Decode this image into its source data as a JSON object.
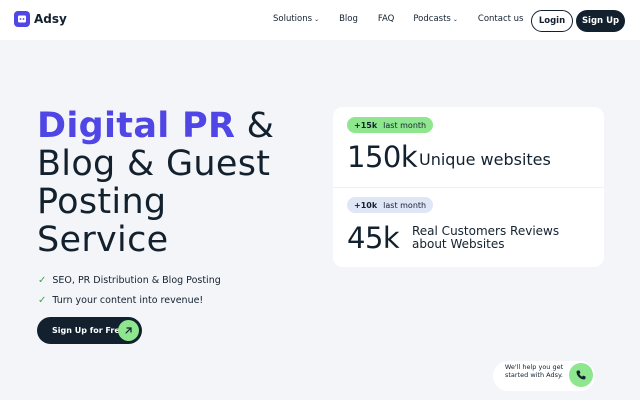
{
  "header": {
    "logo_text": "Adsy",
    "nav": [
      {
        "label": "Solutions",
        "has_dropdown": true
      },
      {
        "label": "Blog",
        "has_dropdown": false
      },
      {
        "label": "FAQ",
        "has_dropdown": false
      },
      {
        "label": "Podcasts",
        "has_dropdown": true
      },
      {
        "label": "Contact us",
        "has_dropdown": false
      }
    ],
    "login_label": "Login",
    "signup_label": "Sign Up"
  },
  "hero": {
    "title_accent": "Digital PR",
    "title_line1_rest": " &",
    "title_line2": "Blog & Guest",
    "title_line3": "Posting",
    "title_line4": "Service",
    "features": [
      "SEO, PR Distribution & Blog Posting",
      "Turn your content into revenue!"
    ],
    "cta_label": "Sign Up for Free"
  },
  "stats": [
    {
      "delta": "+15k",
      "period": "last month",
      "value": "150k",
      "label": "Unique websites"
    },
    {
      "delta": "+10k",
      "period": "last month",
      "value": "45k",
      "label": "Real Customers Reviews about Websites"
    }
  ],
  "chat": {
    "text": "We'll help you get started with Adsy."
  },
  "colors": {
    "accent": "#4f46e5",
    "dark": "#13212f",
    "green": "#8ee68f",
    "background": "#f4f5f9"
  }
}
